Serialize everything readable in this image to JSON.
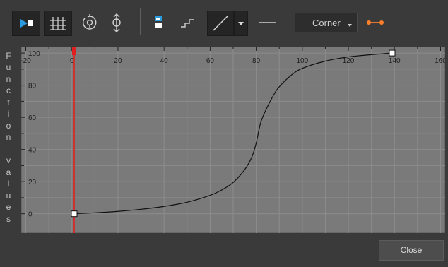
{
  "toolbar": {
    "icons": [
      "play-key-icon",
      "grid-toggle-icon",
      "rotate-key-icon",
      "align-key-icon",
      "smooth-key-icon",
      "stepped-icon",
      "linear-icon",
      "dropdown-arrow-icon",
      "constant-icon",
      "chain-link-icon"
    ],
    "interpolation_label": "Corner"
  },
  "y_axis_title": "Function values",
  "chart_data": {
    "type": "line",
    "title": "",
    "xlabel": "",
    "ylabel": "Function values",
    "xlim": [
      -22,
      162
    ],
    "ylim": [
      -12,
      104
    ],
    "x_ticks": [
      -20,
      0,
      20,
      40,
      60,
      80,
      100,
      120,
      140,
      160
    ],
    "x_tick_labels": [
      "-20",
      "0",
      "20",
      "40",
      "60",
      "80",
      "100",
      "120",
      "140",
      "160"
    ],
    "y_ticks": [
      0,
      20,
      40,
      60,
      80,
      100
    ],
    "y_tick_labels": [
      "0",
      "20",
      "40",
      "60",
      "80",
      "100"
    ],
    "grid": true,
    "current_frame": 1,
    "series": [
      {
        "x": [
          1,
          10,
          20,
          30,
          40,
          50,
          60,
          65,
          70,
          75,
          78,
          80,
          82,
          85,
          88,
          90,
          95,
          100,
          110,
          120,
          130,
          139
        ],
        "y": [
          0,
          0.6,
          1.5,
          2.8,
          4.6,
          7.2,
          11.5,
          14.8,
          19.5,
          27.5,
          35,
          44,
          57,
          67,
          75,
          79,
          86,
          90.5,
          95,
          97.6,
          99,
          100
        ]
      }
    ],
    "keyframes": [
      {
        "x": 1,
        "y": 0
      },
      {
        "x": 139,
        "y": 100
      }
    ],
    "colors": {
      "background": "#7a7a7a",
      "grid": "#8c8c8c",
      "curve": "#111111",
      "playhead": "#e02020"
    }
  },
  "close_label": "Close"
}
